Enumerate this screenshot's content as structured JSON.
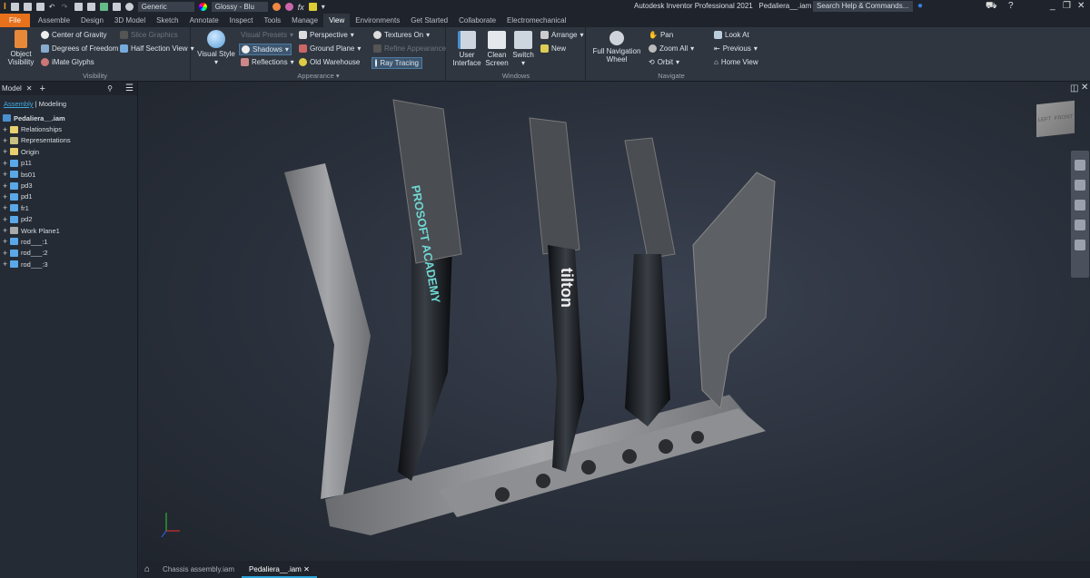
{
  "titlebar": {
    "app_title": "Autodesk Inventor Professional 2021",
    "doc_title": "Pedaliera__.iam",
    "material": "Generic",
    "appearance": "Glossy - Blu",
    "search_placeholder": "Search Help & Commands..."
  },
  "tabs": [
    "File",
    "Assemble",
    "Design",
    "3D Model",
    "Sketch",
    "Annotate",
    "Inspect",
    "Tools",
    "Manage",
    "View",
    "Environments",
    "Get Started",
    "Collaborate",
    "Electromechanical"
  ],
  "active_tab": "View",
  "ribbon": {
    "visibility": {
      "label": "Visibility",
      "object_visibility": "Object Visibility",
      "center_of_gravity": "Center of Gravity",
      "degrees_of_freedom": "Degrees of Freedom",
      "imate_glyphs": "iMate Glyphs",
      "slice_graphics": "Slice Graphics",
      "half_section_view": "Half Section View"
    },
    "appearance": {
      "label": "Appearance ▾",
      "visual_style": "Visual Style",
      "visual_presets": "Visual Presets",
      "shadows": "Shadows",
      "reflections": "Reflections",
      "perspective": "Perspective",
      "ground_plane": "Ground Plane",
      "lighting": "Old Warehouse",
      "textures_on": "Textures On",
      "refine_appearance": "Refine Appearance",
      "ray_tracing": "Ray Tracing"
    },
    "windows": {
      "label": "Windows",
      "user_interface": "User Interface",
      "clean_screen": "Clean Screen",
      "switch": "Switch",
      "arrange": "Arrange",
      "new": "New"
    },
    "navigate": {
      "label": "Navigate",
      "full_nav_wheel": "Full Navigation Wheel",
      "pan": "Pan",
      "zoom_all": "Zoom All",
      "orbit": "Orbit",
      "look_at": "Look At",
      "previous": "Previous",
      "home_view": "Home View"
    }
  },
  "browser": {
    "title": "Model",
    "tab_assembly": "Assembly",
    "tab_modeling": "Modeling",
    "root": "Pedaliera__.iam",
    "items": [
      {
        "label": "Relationships",
        "icon": "folder"
      },
      {
        "label": "Representations",
        "icon": "representations"
      },
      {
        "label": "Origin",
        "icon": "folder"
      },
      {
        "label": "p11",
        "icon": "part"
      },
      {
        "label": "bs01",
        "icon": "subassembly"
      },
      {
        "label": "pd3",
        "icon": "part"
      },
      {
        "label": "pd1",
        "icon": "part"
      },
      {
        "label": "fr1",
        "icon": "subassembly"
      },
      {
        "label": "pd2",
        "icon": "part"
      },
      {
        "label": "Work Plane1",
        "icon": "work-plane"
      },
      {
        "label": "rod___:1",
        "icon": "part"
      },
      {
        "label": "rod___:2",
        "icon": "part"
      },
      {
        "label": "rod___:3",
        "icon": "part"
      }
    ]
  },
  "viewcube": {
    "left": "LEFT",
    "front": "FRONT"
  },
  "model_text": {
    "logo": "PROSOFT ACADEMY",
    "brand": "tilton"
  },
  "doc_tabs": [
    {
      "label": "Chassis assembly.iam",
      "active": false
    },
    {
      "label": "Pedaliera__.iam",
      "active": true
    }
  ],
  "colors": {
    "file_tab": "#e8711c",
    "accent": "#2aa4d8",
    "ribbon": "#2f3640"
  }
}
